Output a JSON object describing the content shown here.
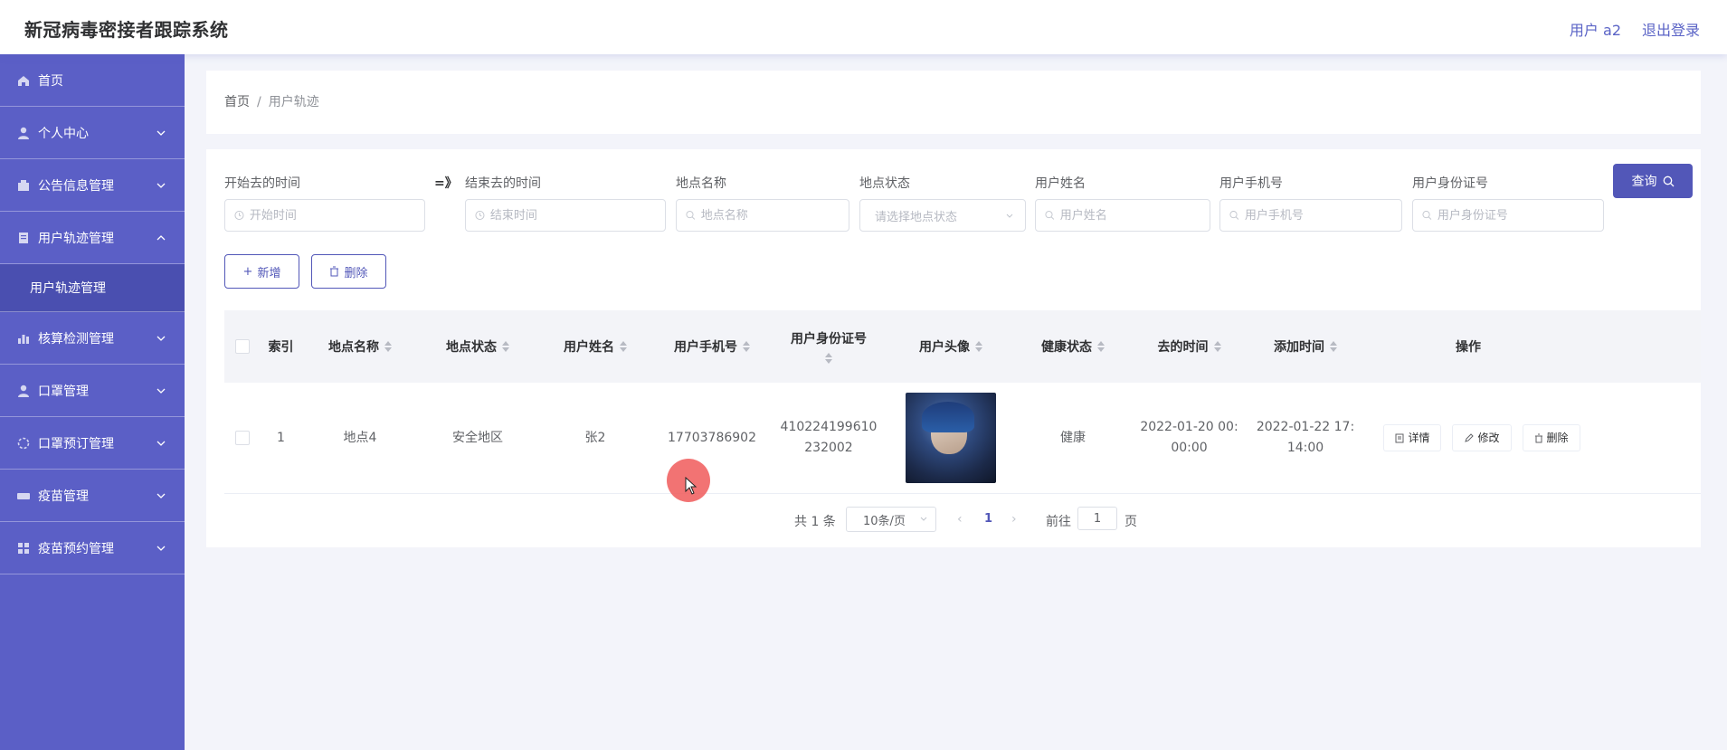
{
  "header": {
    "title": "新冠病毒密接者跟踪系统",
    "user_label": "用户 a2",
    "logout_label": "退出登录"
  },
  "sidebar": {
    "items": [
      {
        "label": "首页",
        "icon": "home-icon"
      },
      {
        "label": "个人中心",
        "icon": "user-icon"
      },
      {
        "label": "公告信息管理",
        "icon": "notice-icon"
      },
      {
        "label": "用户轨迹管理",
        "icon": "track-icon",
        "expanded": true
      },
      {
        "label": "核算检测管理",
        "icon": "chart-icon"
      },
      {
        "label": "口罩管理",
        "icon": "mask-icon"
      },
      {
        "label": "口罩预订管理",
        "icon": "order-icon"
      },
      {
        "label": "疫苗管理",
        "icon": "vaccine-icon"
      },
      {
        "label": "疫苗预约管理",
        "icon": "grid-icon"
      }
    ],
    "sub_item": "用户轨迹管理"
  },
  "breadcrumb": {
    "home": "首页",
    "separator": "/",
    "current": "用户轨迹"
  },
  "filters": {
    "start_time_label": "开始去的时间",
    "start_time_placeholder": "开始时间",
    "range_sep": "=》",
    "end_time_label": "结束去的时间",
    "end_time_placeholder": "结束时间",
    "place_name_label": "地点名称",
    "place_name_placeholder": "地点名称",
    "place_status_label": "地点状态",
    "place_status_placeholder": "请选择地点状态",
    "user_name_label": "用户姓名",
    "user_name_placeholder": "用户姓名",
    "user_phone_label": "用户手机号",
    "user_phone_placeholder": "用户手机号",
    "user_id_label": "用户身份证号",
    "user_id_placeholder": "用户身份证号",
    "query_label": "查询"
  },
  "actions": {
    "add_label": "新增",
    "delete_label": "删除"
  },
  "table": {
    "columns": [
      "索引",
      "地点名称",
      "地点状态",
      "用户姓名",
      "用户手机号",
      "用户身份证号",
      "用户头像",
      "健康状态",
      "去的时间",
      "添加时间",
      "操作"
    ],
    "rows": [
      {
        "index": "1",
        "place_name": "地点4",
        "place_status": "安全地区",
        "user_name": "张2",
        "phone": "17703786902",
        "id_line1": "410224199610",
        "id_line2": "232002",
        "health": "健康",
        "go_time_line1": "2022-01-20 00:",
        "go_time_line2": "00:00",
        "add_time_line1": "2022-01-22 17:",
        "add_time_line2": "14:00",
        "op_detail": "详情",
        "op_edit": "修改",
        "op_delete": "删除"
      }
    ]
  },
  "pagination": {
    "total_text": "共 1 条",
    "page_size": "10条/页",
    "current_page": "1",
    "goto_label": "前往",
    "goto_value": "1",
    "page_unit": "页"
  },
  "colors": {
    "sidebar_bg": "#5b5fc6",
    "sidebar_active_bg": "#4a4fb0",
    "primary": "#5257b8",
    "page_bg": "#f3f4fa"
  }
}
